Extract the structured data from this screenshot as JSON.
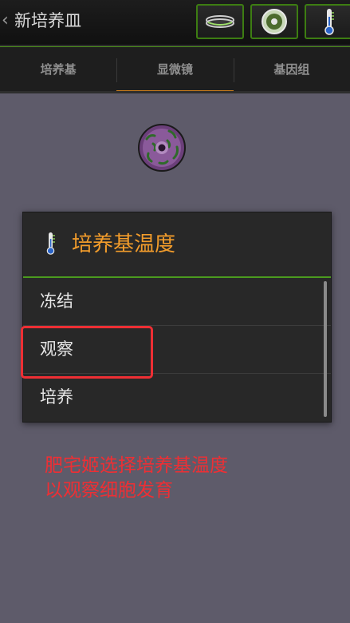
{
  "header": {
    "back_icon": "chevron-left-icon",
    "title": "新培养皿",
    "tools": [
      {
        "name": "dish-lid-icon"
      },
      {
        "name": "petri-dish-icon"
      },
      {
        "name": "thermometer-icon"
      }
    ]
  },
  "tabs": [
    {
      "label": "培养基",
      "active": false
    },
    {
      "label": "显微镜",
      "active": true
    },
    {
      "label": "基因组",
      "active": false
    }
  ],
  "dialog": {
    "icon": "thermometer-icon",
    "title": "培养基温度",
    "options": [
      "冻结",
      "观察",
      "培养"
    ],
    "highlighted_option": "观察"
  },
  "annotation": {
    "line1": "肥宅姬选择培养基温度",
    "line2": "以观察细胞发育"
  },
  "colors": {
    "accent_green": "#4b9a1e",
    "title_orange": "#f29c2b",
    "active_tab": "#c97c1c",
    "annotation_red": "#ee2f34",
    "background": "#5e5b6a"
  }
}
